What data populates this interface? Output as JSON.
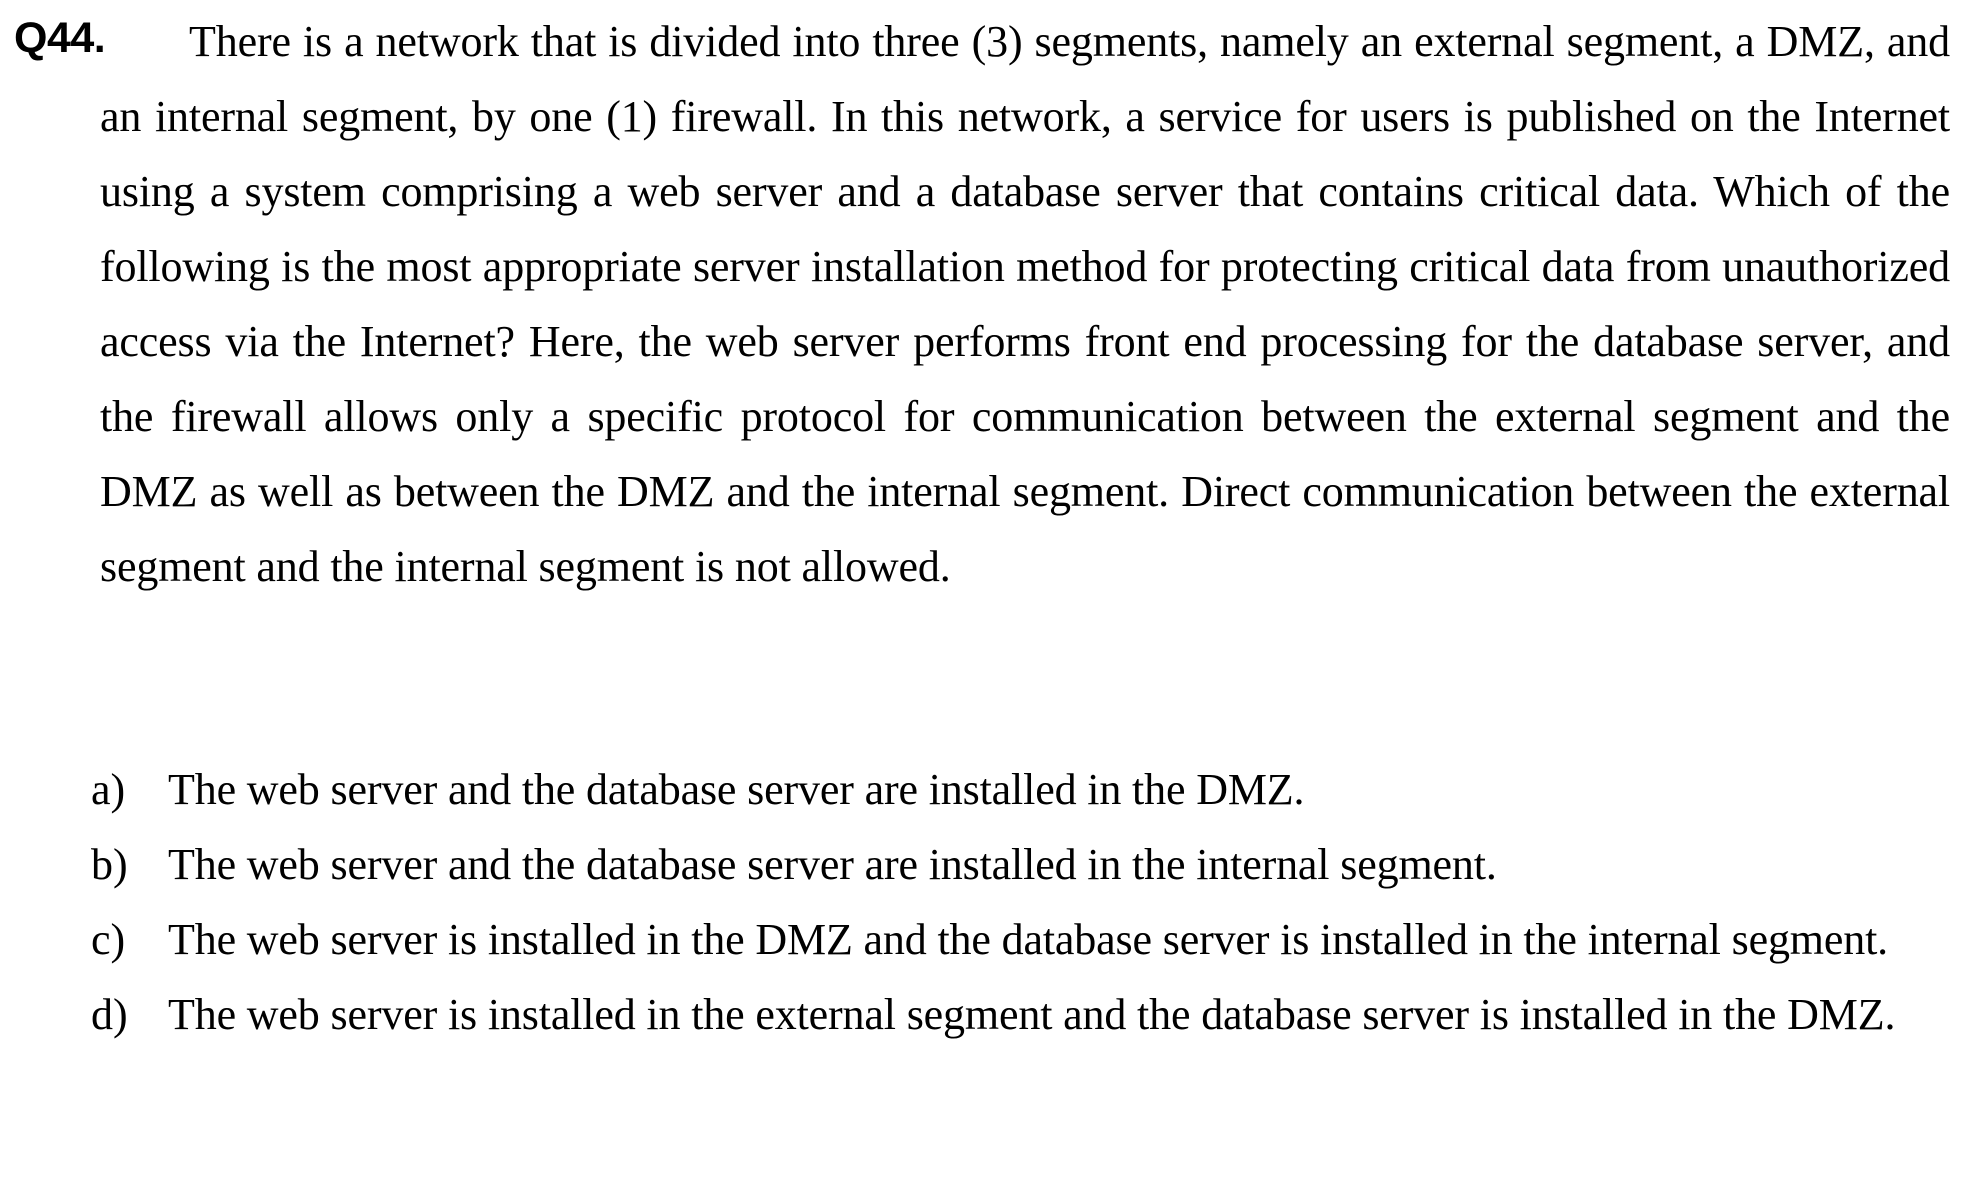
{
  "question": {
    "number": "Q44.",
    "text": "There is a network that is divided into three (3) segments, namely an external segment, a DMZ, and an internal segment, by one (1) firewall. In this network, a service for users is published on the Internet using a system comprising a web server and a database server that contains critical data. Which of the following is the most appropriate server installation method for protecting critical data from unauthorized access via the Internet? Here, the web server performs front end processing for the database server, and the firewall allows only a specific protocol for communication between the external segment and the DMZ as well as between the DMZ and the internal segment. Direct communication between the external segment and the internal segment is not allowed."
  },
  "options": [
    {
      "letter": "a)",
      "text": "The web server and the database server are installed in the DMZ."
    },
    {
      "letter": "b)",
      "text": "The web server and the database server are installed in the internal segment."
    },
    {
      "letter": "c)",
      "text": "The web server is installed in the DMZ and the database server is installed in the internal segment."
    },
    {
      "letter": "d)",
      "text": "The web server is installed in the external segment and the database server is installed in the DMZ."
    }
  ]
}
